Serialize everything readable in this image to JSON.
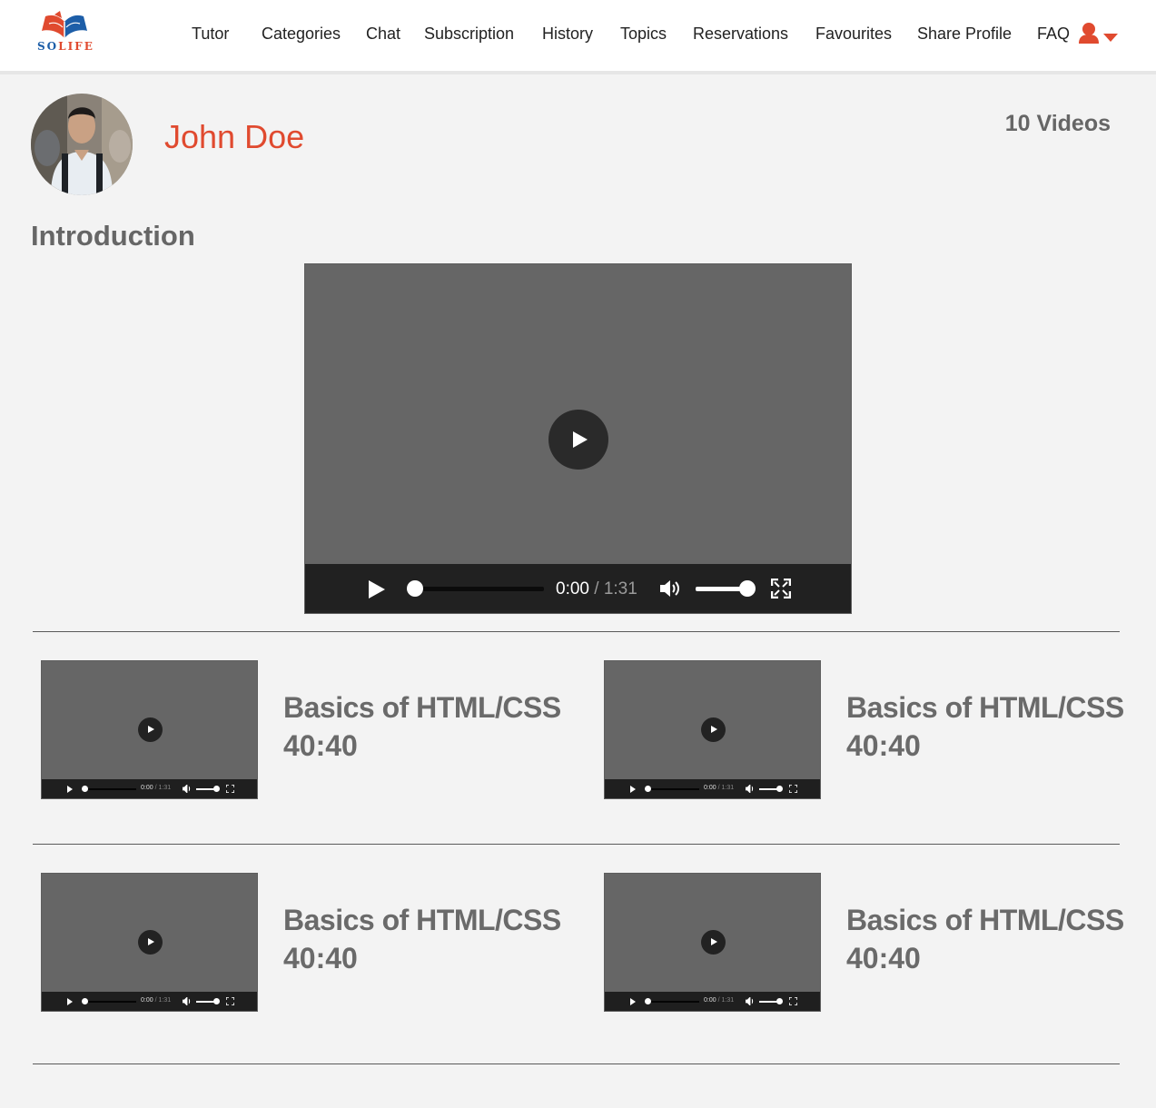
{
  "brand": {
    "name_prefix": "SO",
    "name_suffix": "LIFE",
    "primary_color": "#e04a2f",
    "secondary_color": "#1d5ea8"
  },
  "nav": {
    "items": [
      "Tutor",
      "Categories",
      "Chat",
      "Subscription",
      "History",
      "Topics",
      "Reservations",
      "Favourites",
      "Share Profile",
      "FAQ"
    ],
    "user_icon": "user-icon",
    "dropdown_icon": "caret-down-icon"
  },
  "profile": {
    "name": "John Doe",
    "video_count": "10 Videos"
  },
  "intro": {
    "title": "Introduction",
    "player": {
      "current_time": "0:00",
      "separator": "/",
      "duration": "1:31",
      "progress": 0,
      "volume": 1
    }
  },
  "videos": [
    {
      "title": "Basics of HTML/CSS",
      "duration": "40:40",
      "player_time": "0:00",
      "player_duration": "1:31"
    },
    {
      "title": "Basics of HTML/CSS",
      "duration": "40:40",
      "player_time": "0:00",
      "player_duration": "1:31"
    },
    {
      "title": "Basics of HTML/CSS",
      "duration": "40:40",
      "player_time": "0:00",
      "player_duration": "1:31"
    },
    {
      "title": "Basics of HTML/CSS",
      "duration": "40:40",
      "player_time": "0:00",
      "player_duration": "1:31"
    }
  ]
}
